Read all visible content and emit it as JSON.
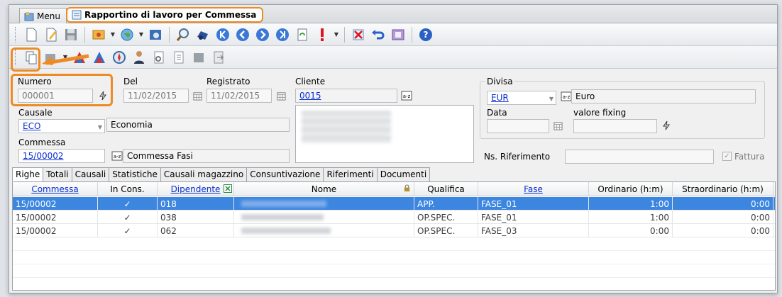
{
  "tabs": [
    {
      "label": "Menu",
      "icon": "home-menu-icon"
    },
    {
      "label": "Rapportino di lavoro per Commessa",
      "icon": "document-form-icon"
    }
  ],
  "toolbar1_icons": [
    "new-document-icon",
    "edit-document-icon",
    "save-icon",
    "module-dropdown-icon",
    "globe-dropdown-icon",
    "settings-icon",
    "search-icon",
    "binoculars-icon",
    "first-record-icon",
    "previous-record-icon",
    "next-record-icon",
    "last-record-icon",
    "refresh-icon",
    "alert-icon",
    "more-dropdown-icon",
    "delete-icon",
    "undo-icon",
    "print-icon",
    "help-icon"
  ],
  "toolbar2_icons": [
    "copy-document-icon",
    "dropdown-tool-icon",
    "chart-icon",
    "chart-alt-icon",
    "compass-icon",
    "person-icon",
    "document-search-icon",
    "document-list-icon",
    "puzzle-icon",
    "document-export-icon"
  ],
  "form": {
    "numero_label": "Numero",
    "numero_value": "000001",
    "del_label": "Del",
    "del_value": "11/02/2015",
    "registrato_label": "Registrato",
    "registrato_value": "11/02/2015",
    "cliente_label": "Cliente",
    "cliente_code": "0015",
    "causale_label": "Causale",
    "causale_code": "ECO",
    "causale_desc": "Economia",
    "commessa_label": "Commessa",
    "commessa_code": "15/00002",
    "commessa_desc": "Commessa Fasi",
    "divisa_label": "Divisa",
    "divisa_code": "EUR",
    "divisa_desc": "Euro",
    "data_label": "Data",
    "fixing_label": "valore fixing",
    "nsrif_label": "Ns. Riferimento",
    "fattura_label": "Fattura"
  },
  "lower_tabs": [
    "Righe",
    "Totali",
    "Causali",
    "Statistiche",
    "Causali magazzino",
    "Consuntivazione",
    "Riferimenti",
    "Documenti"
  ],
  "grid": {
    "headers": [
      "Commessa",
      "In Cons.",
      "Dipendente",
      "Nome",
      "Qualifica",
      "Fase",
      "Ordinario (h:m)",
      "Straordinario (h:m)"
    ],
    "rows": [
      {
        "commessa": "15/00002",
        "incons": "✓",
        "dipendente": "018",
        "qualifica": "APP.",
        "fase": "FASE_01",
        "ordinario": "1:00",
        "straordinario": "0:00"
      },
      {
        "commessa": "15/00002",
        "incons": "✓",
        "dipendente": "038",
        "qualifica": "OP.SPEC.",
        "fase": "FASE_01",
        "ordinario": "1:00",
        "straordinario": "0:00"
      },
      {
        "commessa": "15/00002",
        "incons": "✓",
        "dipendente": "062",
        "qualifica": "OP.SPEC.",
        "fase": "FASE_03",
        "ordinario": "0:00",
        "straordinario": "0:00"
      }
    ]
  },
  "colors": {
    "accent": "#ee8a24",
    "selection": "#3d86e0",
    "link": "#0a2fd0"
  }
}
